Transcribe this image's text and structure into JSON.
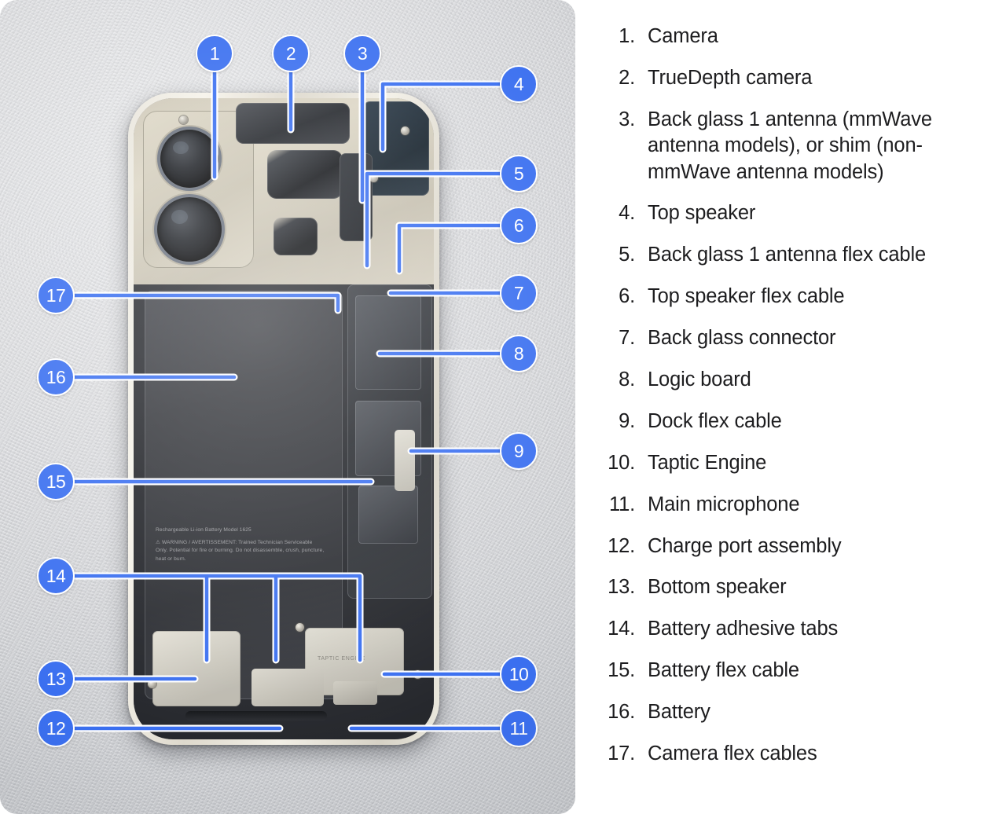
{
  "diagram": {
    "subject": "iPhone internal components exploded callout diagram",
    "accent_color": "#3a6ff0",
    "bubble_border_color": "#ffffff",
    "panel_background": "#d4d6d9",
    "text_color": "#1d1d1f"
  },
  "device": {
    "battery_label_line1": "Rechargeable Li-ion Battery Model 1625",
    "battery_label_line2": "⚠ WARNING / AVERTISSEMENT: Trained Technician Serviceable Only. Potential for fire or burning. Do not disassemble, crush, puncture, heat or burn.",
    "taptic_label": "TAPTIC ENGINE"
  },
  "callouts": [
    {
      "number": "1",
      "label": "Camera"
    },
    {
      "number": "2",
      "label": "TrueDepth camera"
    },
    {
      "number": "3",
      "label": "Back glass 1 antenna"
    },
    {
      "number": "4",
      "label": "Top speaker"
    },
    {
      "number": "5",
      "label": "Back glass 1 antenna flex cable"
    },
    {
      "number": "6",
      "label": "Top speaker flex cable"
    },
    {
      "number": "7",
      "label": "Back glass connector"
    },
    {
      "number": "8",
      "label": "Logic board"
    },
    {
      "number": "9",
      "label": "Dock flex cable"
    },
    {
      "number": "10",
      "label": "Taptic Engine"
    },
    {
      "number": "11",
      "label": "Main microphone"
    },
    {
      "number": "12",
      "label": "Charge port assembly"
    },
    {
      "number": "13",
      "label": "Bottom speaker"
    },
    {
      "number": "14",
      "label": "Battery adhesive tabs"
    },
    {
      "number": "15",
      "label": "Battery flex cable"
    },
    {
      "number": "16",
      "label": "Battery"
    },
    {
      "number": "17",
      "label": "Camera flex cables"
    }
  ],
  "legend": {
    "items": [
      "Camera",
      "TrueDepth camera",
      "Back glass 1 antenna (mmWave antenna models), or shim (non-mmWave antenna models)",
      "Top speaker",
      "Back glass 1 antenna flex cable",
      "Top speaker flex cable",
      "Back glass connector",
      "Logic board",
      "Dock flex cable",
      "Taptic Engine",
      "Main microphone",
      "Charge port assembly",
      "Bottom speaker",
      "Battery adhesive tabs",
      "Battery flex cable",
      "Battery",
      "Camera flex cables"
    ]
  }
}
